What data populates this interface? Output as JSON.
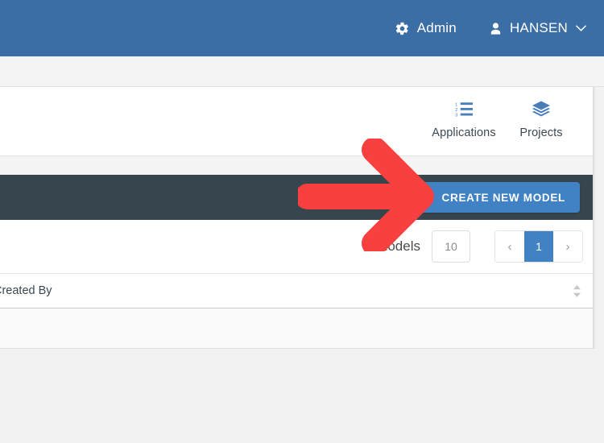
{
  "topbar": {
    "background_color": "#3b6ea5",
    "items": [
      {
        "label": "Admin",
        "icon": "gear-icon"
      },
      {
        "label": "HANSEN",
        "icon": "user-icon",
        "caret": "⌄"
      }
    ]
  },
  "nav": {
    "items": [
      {
        "label": "Applications",
        "icon": "ordered-list-icon"
      },
      {
        "label": "Projects",
        "icon": "layers-icon"
      }
    ],
    "icon_color": "#4a7ebb"
  },
  "toolbar": {
    "background_color": "#36454e",
    "create_button": {
      "label": "CREATE NEW MODEL",
      "plus": "+",
      "color": "#4182c4"
    }
  },
  "listing": {
    "count_text": "0 models",
    "page_size": "10",
    "pagination": {
      "prev": "‹",
      "next": "›",
      "pages": [
        "1"
      ],
      "active_page": "1",
      "active_color": "#4182c4"
    }
  },
  "table": {
    "columns": [
      {
        "label": "Created By",
        "sortable": true
      }
    ],
    "rows": []
  },
  "annotation": {
    "arrow": {
      "color": "#f7403f",
      "direction": "right",
      "points_at": "create-new-model-button"
    }
  }
}
